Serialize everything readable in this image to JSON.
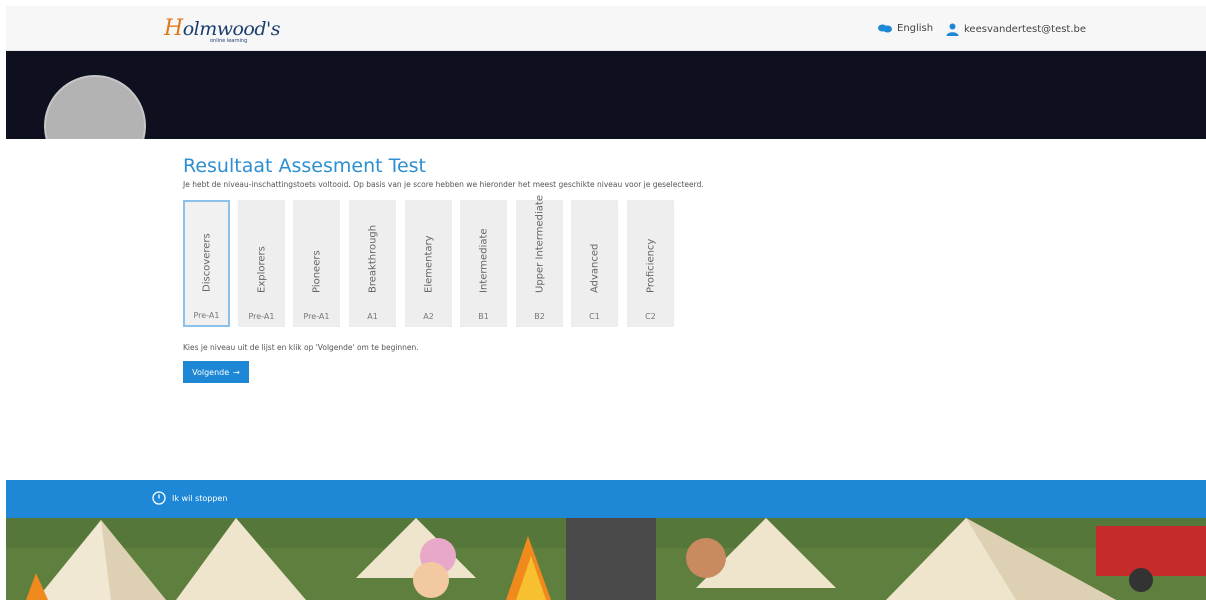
{
  "header": {
    "logo_text": "Holmwood's",
    "logo_sub": "online learning",
    "language_label": "English",
    "user_email": "keesvandertest@test.be"
  },
  "main": {
    "title": "Resultaat Assesment Test",
    "subtitle": "Je hebt de niveau-inschattingstoets voltooid. Op basis van je score hebben we hieronder het meest geschikte niveau voor je geselecteerd.",
    "levels": [
      {
        "name": "Discoverers",
        "code": "Pre-A1",
        "selected": true
      },
      {
        "name": "Explorers",
        "code": "Pre-A1",
        "selected": false
      },
      {
        "name": "Pioneers",
        "code": "Pre-A1",
        "selected": false
      },
      {
        "name": "Breakthrough",
        "code": "A1",
        "selected": false
      },
      {
        "name": "Elementary",
        "code": "A2",
        "selected": false
      },
      {
        "name": "Intermediate",
        "code": "B1",
        "selected": false
      },
      {
        "name": "Upper Intermediate",
        "code": "B2",
        "selected": false
      },
      {
        "name": "Advanced",
        "code": "C1",
        "selected": false
      },
      {
        "name": "Proficiency",
        "code": "C2",
        "selected": false
      }
    ],
    "instruction": "Kies je niveau uit de lijst en klik op 'Volgende' om te beginnen.",
    "next_label": "Volgende",
    "next_arrow": "→"
  },
  "footer": {
    "stop_label": "Ik wil stoppen"
  },
  "colors": {
    "accent": "#1e88d6",
    "title": "#2c8fd1",
    "hero": "#0e0f1f",
    "selected_border": "#8cc2ea"
  },
  "icons": {
    "language": "chat-bubbles-icon",
    "user": "user-icon",
    "stop": "power-icon",
    "next": "arrow-right-icon"
  }
}
